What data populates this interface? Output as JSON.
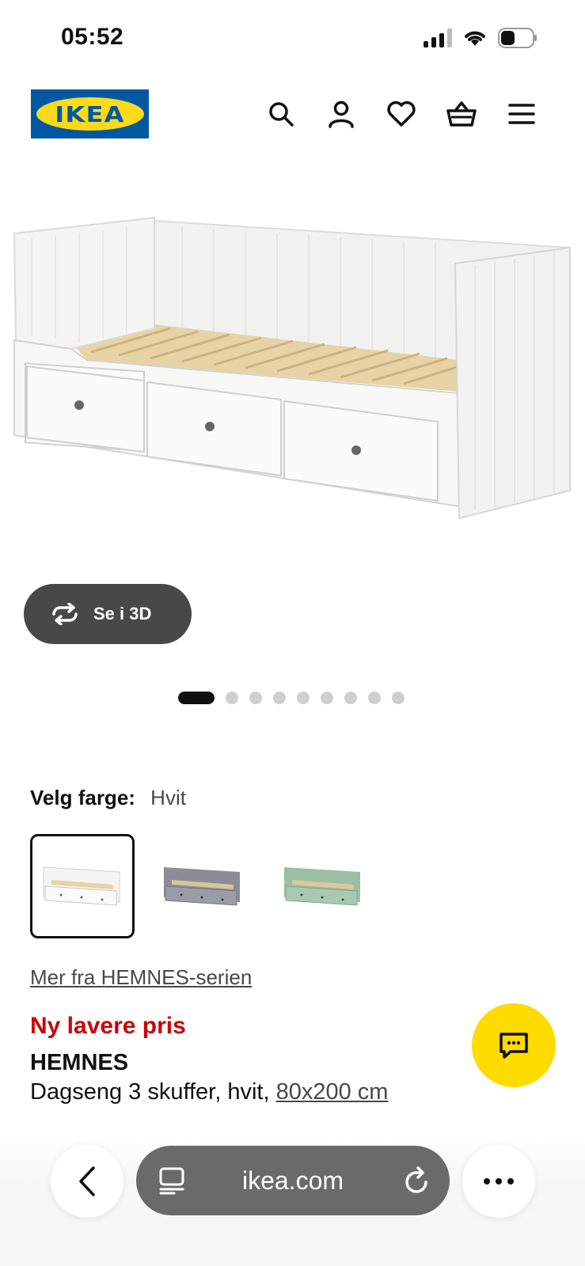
{
  "status": {
    "time": "05:52"
  },
  "header": {
    "logo_text": "IKEA",
    "icons": [
      "search-icon",
      "account-icon",
      "heart-icon",
      "basket-icon",
      "menu-icon"
    ]
  },
  "product": {
    "view_3d_label": "Se i 3D",
    "image_count": 9,
    "active_image": 1,
    "color_label": "Velg farge:",
    "color_value": "Hvit",
    "swatches": [
      {
        "name": "Hvit",
        "color": "#f2f2f2",
        "selected": true
      },
      {
        "name": "Grå",
        "color": "#8a8d96",
        "selected": false
      },
      {
        "name": "Grønn",
        "color": "#9bbfa5",
        "selected": false
      }
    ],
    "series_link": "Mer fra HEMNES-serien",
    "price_tag": "Ny lavere pris",
    "name": "HEMNES",
    "description": "Dagseng 3 skuffer, hvit, ",
    "size": "80x200 cm"
  },
  "browser": {
    "url": "ikea.com"
  },
  "colors": {
    "ikea_blue": "#0058a3",
    "ikea_yellow": "#ffda1a",
    "price_red": "#cc0008"
  }
}
